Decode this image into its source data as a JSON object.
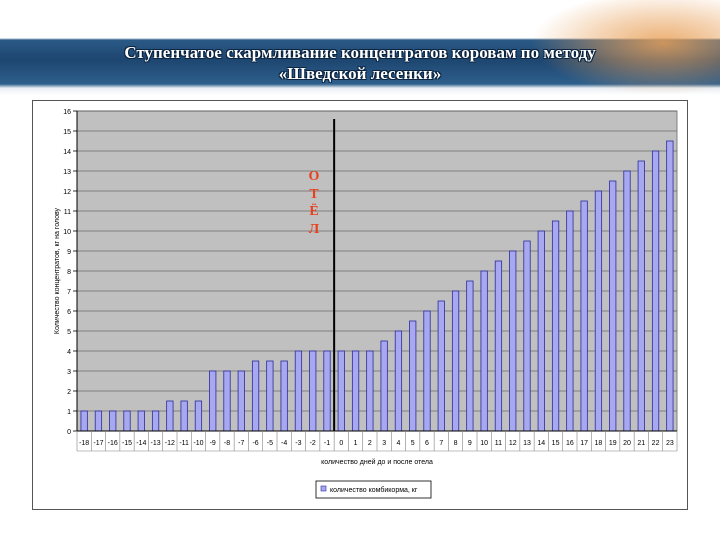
{
  "slide": {
    "title_line1": "Ступенчатое скармливание концентратов коровам по методу",
    "title_line2": "«Шведской лесенки»",
    "annotation": "О\nТ\nЁ\nЛ"
  },
  "colors": {
    "bar_fill": "#a8a8f0",
    "bar_stroke": "#2b2b9b",
    "plot_background": "#c0c0c0",
    "annotation": "#e8401c",
    "banner": "#1d4670"
  },
  "chart_data": {
    "type": "bar",
    "ylabel": "Количество концентратов, кг на голову",
    "xlabel": "количество дней до и после отела",
    "ylim": [
      0,
      16
    ],
    "yticks": [
      0,
      1,
      2,
      3,
      4,
      5,
      6,
      7,
      8,
      9,
      10,
      11,
      12,
      13,
      14,
      15,
      16
    ],
    "grid": true,
    "legend_position": "bottom",
    "marker_line_at": "0",
    "categories": [
      "-18",
      "-17",
      "-16",
      "-15",
      "-14",
      "-13",
      "-12",
      "-11",
      "-10",
      "-9",
      "-8",
      "-7",
      "-6",
      "-5",
      "-4",
      "-3",
      "-2",
      "-1",
      "0",
      "1",
      "2",
      "3",
      "4",
      "5",
      "6",
      "7",
      "8",
      "9",
      "10",
      "11",
      "12",
      "13",
      "14",
      "15",
      "16",
      "17",
      "18",
      "19",
      "20",
      "21",
      "22",
      "23"
    ],
    "series": [
      {
        "name": "количество комбикорма, кг",
        "values": [
          1,
          1,
          1,
          1,
          1,
          1,
          1.5,
          1.5,
          1.5,
          3,
          3,
          3,
          3.5,
          3.5,
          3.5,
          4,
          4,
          4,
          4,
          4,
          4,
          4.5,
          5,
          5.5,
          6,
          6.5,
          7,
          7.5,
          8,
          8.5,
          9,
          9.5,
          10,
          10.5,
          11,
          11.5,
          12,
          12.5,
          13,
          13.5,
          14,
          14.5
        ]
      }
    ]
  }
}
